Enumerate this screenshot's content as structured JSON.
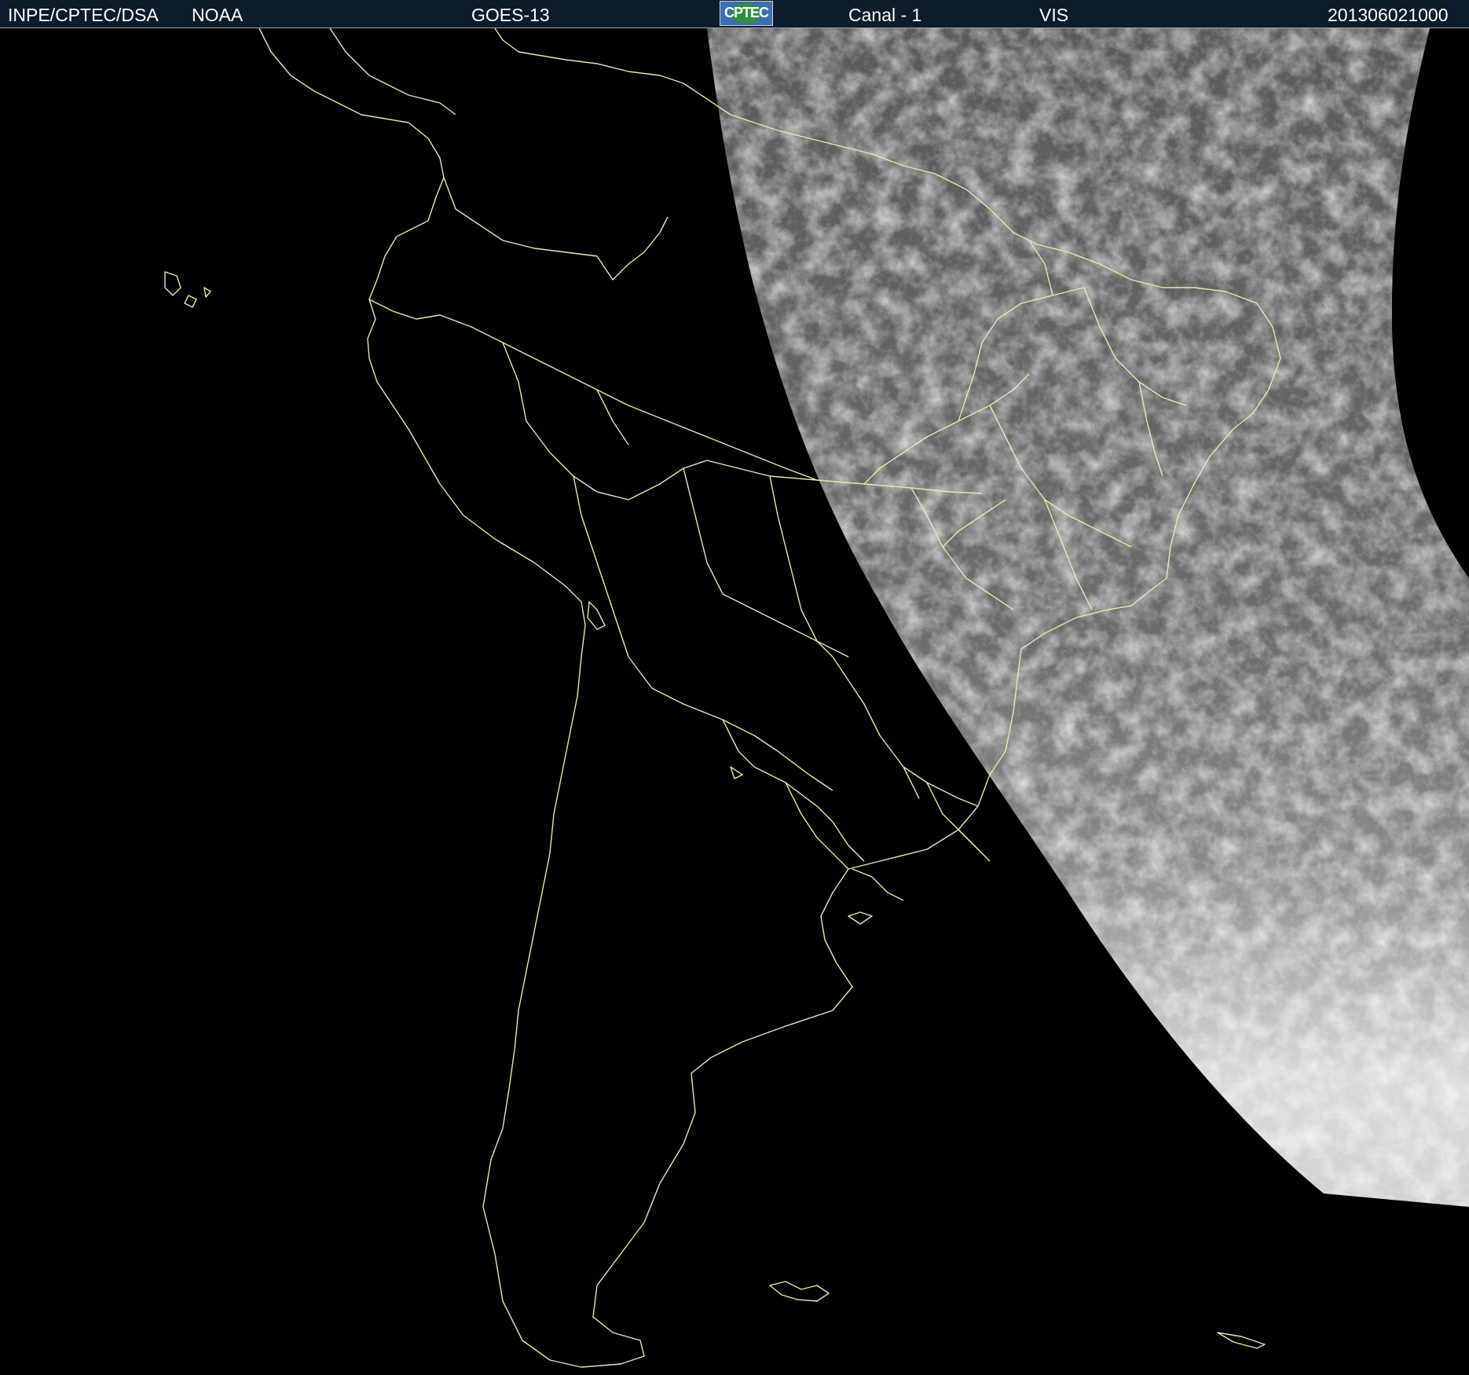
{
  "header": {
    "organization": "INPE/CPTEC/DSA",
    "agency": "NOAA",
    "satellite": "GOES-13",
    "logo_text": "CPTEC",
    "channel": "Canal - 1",
    "band": "VIS",
    "timestamp": "201306021000"
  },
  "map": {
    "background_color": "#000000",
    "coastline_color": "#e8e8b0",
    "region": "South America",
    "image_type": "visible satellite image, partial daylight disk"
  }
}
